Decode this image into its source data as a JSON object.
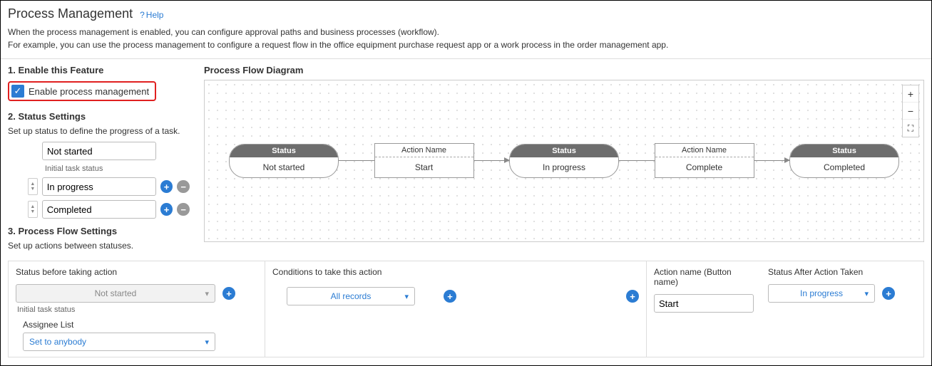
{
  "header": {
    "title": "Process Management",
    "help_label": "Help"
  },
  "description": {
    "line1": "When the process management is enabled, you can configure approval paths and business processes (workflow).",
    "line2": "For example, you can use the process management to configure a request flow in the office equipment purchase request app or a work process in the order management app."
  },
  "section1": {
    "title": "1. Enable this Feature",
    "checkbox_label": "Enable process management",
    "checked": true
  },
  "section2": {
    "title": "2. Status Settings",
    "subtitle": "Set up status to define the progress of a task.",
    "initial_label": "Initial task status",
    "statuses": [
      {
        "value": "Not started",
        "initial": true
      },
      {
        "value": "In progress",
        "initial": false
      },
      {
        "value": "Completed",
        "initial": false
      }
    ]
  },
  "diagram": {
    "title": "Process Flow Diagram",
    "status_header": "Status",
    "action_header": "Action Name",
    "nodes": [
      {
        "type": "status",
        "label": "Not started"
      },
      {
        "type": "action",
        "label": "Start"
      },
      {
        "type": "status",
        "label": "In progress"
      },
      {
        "type": "action",
        "label": "Complete"
      },
      {
        "type": "status",
        "label": "Completed"
      }
    ]
  },
  "section3": {
    "title": "3. Process Flow Settings",
    "subtitle": "Set up actions between statuses."
  },
  "flow_table": {
    "headers": {
      "before": "Status before taking action",
      "conditions": "Conditions to take this action",
      "action_name": "Action name (Button name)",
      "after": "Status After Action Taken"
    },
    "row": {
      "before_value": "Not started",
      "before_note": "Initial task status",
      "assignee_label": "Assignee List",
      "assignee_value": "Set to anybody",
      "condition_value": "All records",
      "action_name_value": "Start",
      "after_value": "In progress"
    }
  }
}
